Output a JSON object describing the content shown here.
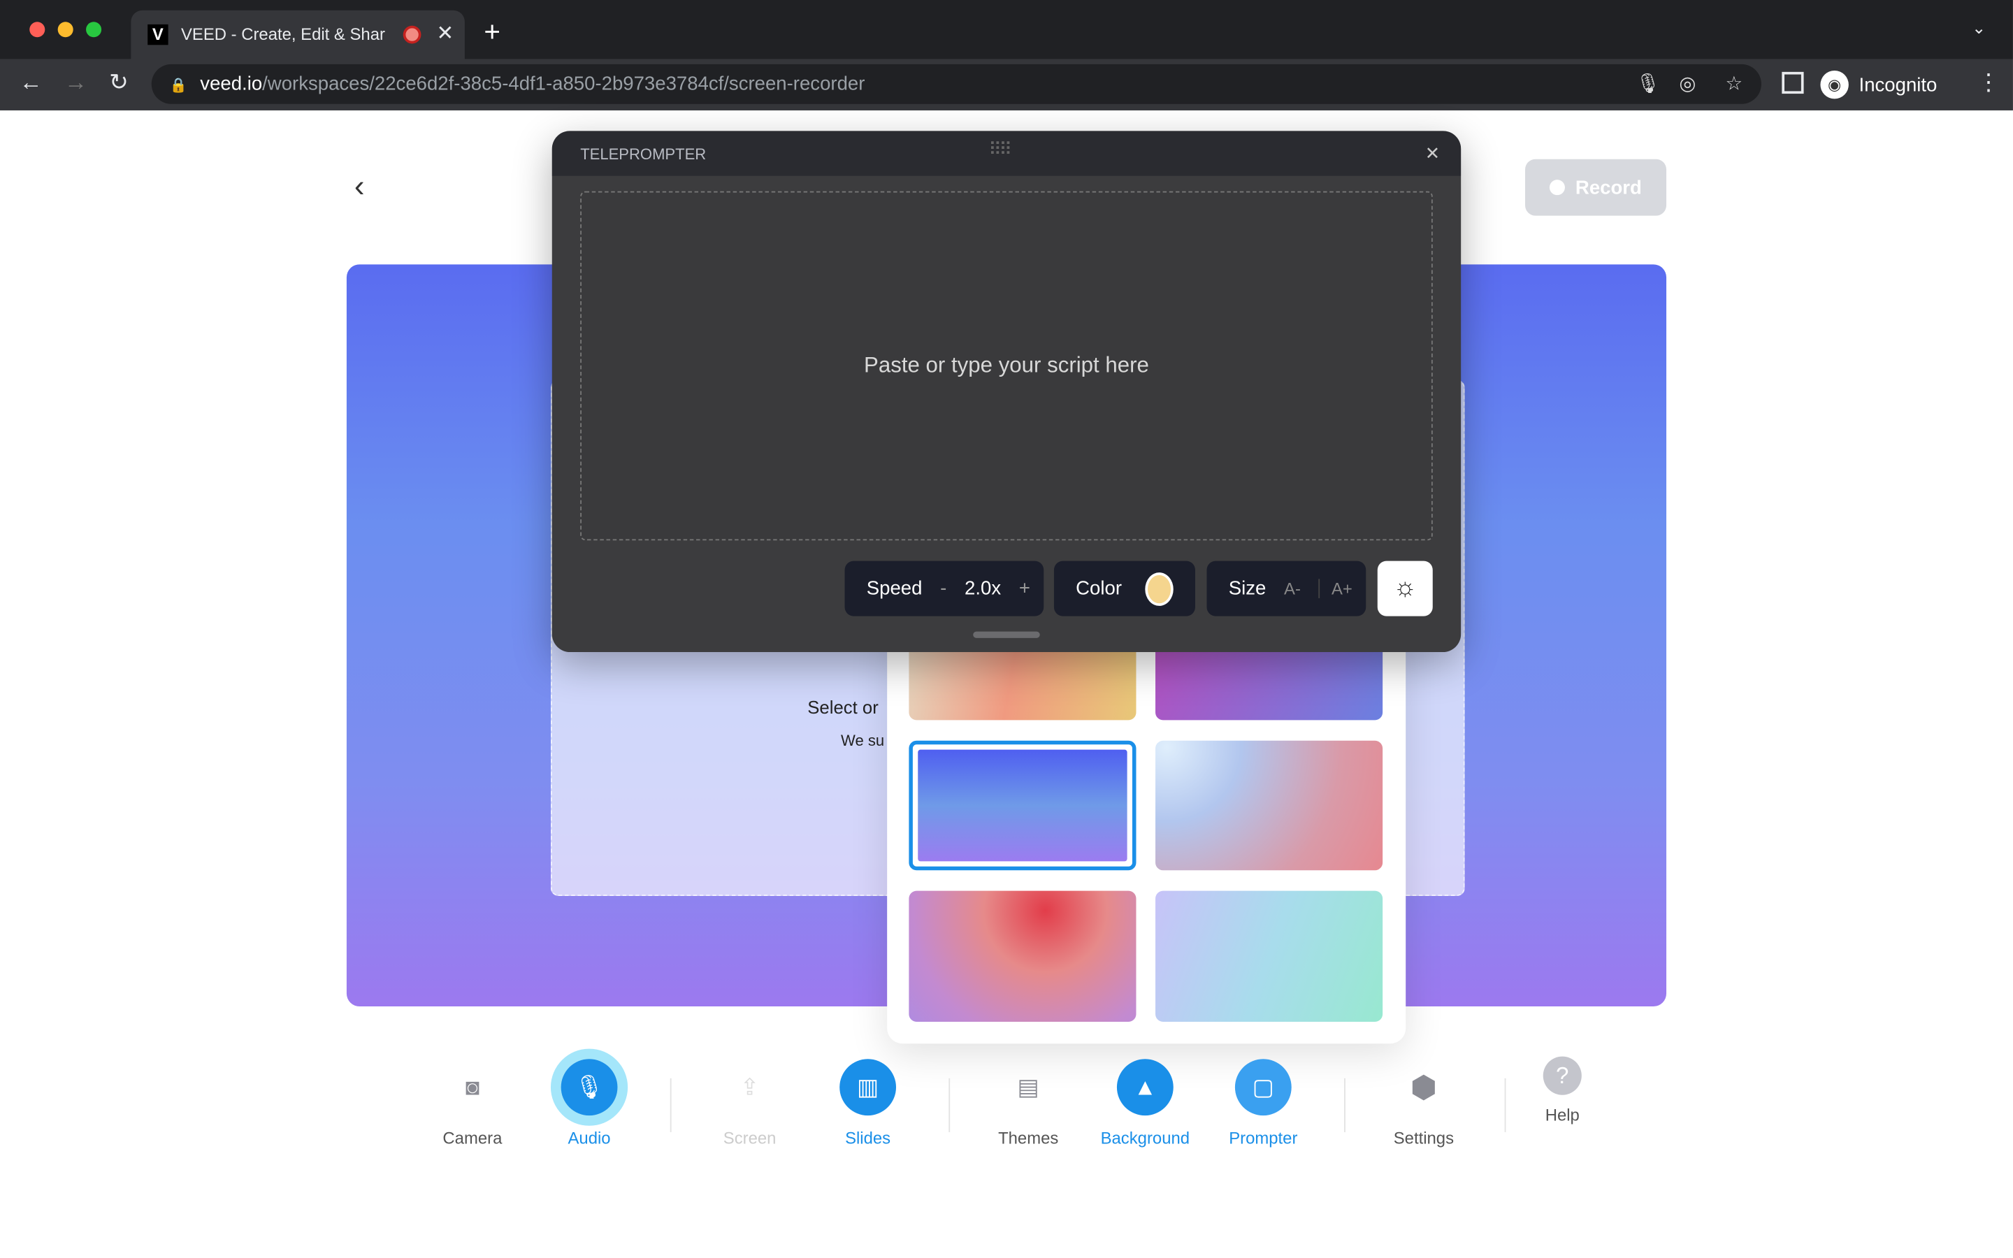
{
  "browser": {
    "tab_title": "VEED - Create, Edit & Shar",
    "url_domain": "veed.io",
    "url_path": "/workspaces/22ce6d2f-38c5-4df1-a850-2b973e3784cf/screen-recorder",
    "profile": "Incognito",
    "favicon": "V"
  },
  "page": {
    "record_label": "Record",
    "select_text": "Select or",
    "sub_text": "We su"
  },
  "teleprompter": {
    "title": "TELEPROMPTER",
    "placeholder": "Paste or type your script here",
    "speed_label": "Speed",
    "speed_minus": "-",
    "speed_value": "2.0x",
    "speed_plus": "+",
    "color_label": "Color",
    "color_value": "#f5d58e",
    "size_label": "Size",
    "size_down": "A-",
    "size_up": "A+"
  },
  "toolbar": {
    "items": [
      {
        "label": "Camera",
        "state": "inactive"
      },
      {
        "label": "Audio",
        "state": "active"
      },
      {
        "label": "Screen",
        "state": "disabled"
      },
      {
        "label": "Slides",
        "state": "active"
      },
      {
        "label": "Themes",
        "state": "inactive"
      },
      {
        "label": "Background",
        "state": "active"
      },
      {
        "label": "Prompter",
        "state": "active"
      },
      {
        "label": "Settings",
        "state": "inactive"
      },
      {
        "label": "Help",
        "state": "inactive"
      }
    ]
  },
  "colors": {
    "accent": "#1a8fe8",
    "selected_border": "#1a8fe8"
  }
}
